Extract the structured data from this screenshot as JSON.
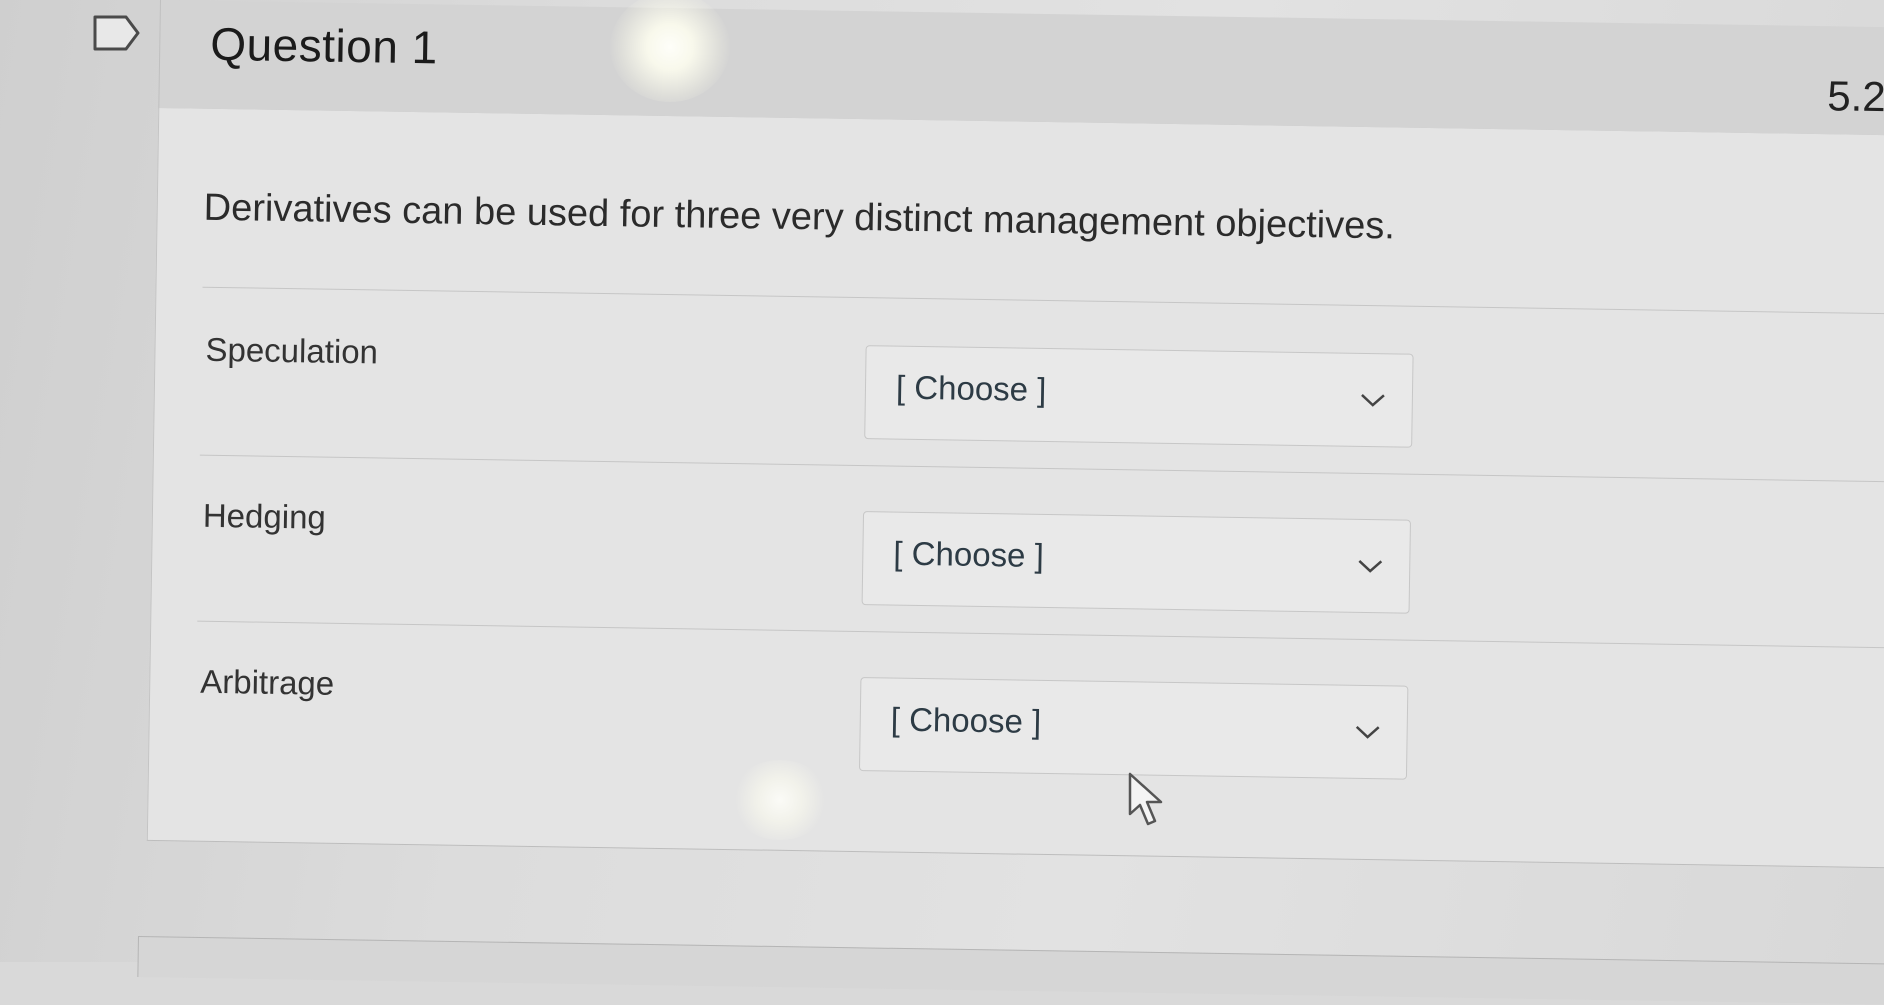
{
  "question": {
    "title": "Question 1",
    "points": "5.2",
    "text": "Derivatives can be used for three very distinct management objectives."
  },
  "answers": [
    {
      "label": "Speculation",
      "selected": "[ Choose ]"
    },
    {
      "label": "Hedging",
      "selected": "[ Choose ]"
    },
    {
      "label": "Arbitrage",
      "selected": "[ Choose ]"
    }
  ],
  "icons": {
    "flag": "flag-icon",
    "dropdown": "chevron-down-icon",
    "cursor": "mouse-pointer-icon"
  },
  "colors": {
    "text": "#2d3b45",
    "border": "#c7c7c7",
    "header_bg": "#d3d3d3"
  }
}
